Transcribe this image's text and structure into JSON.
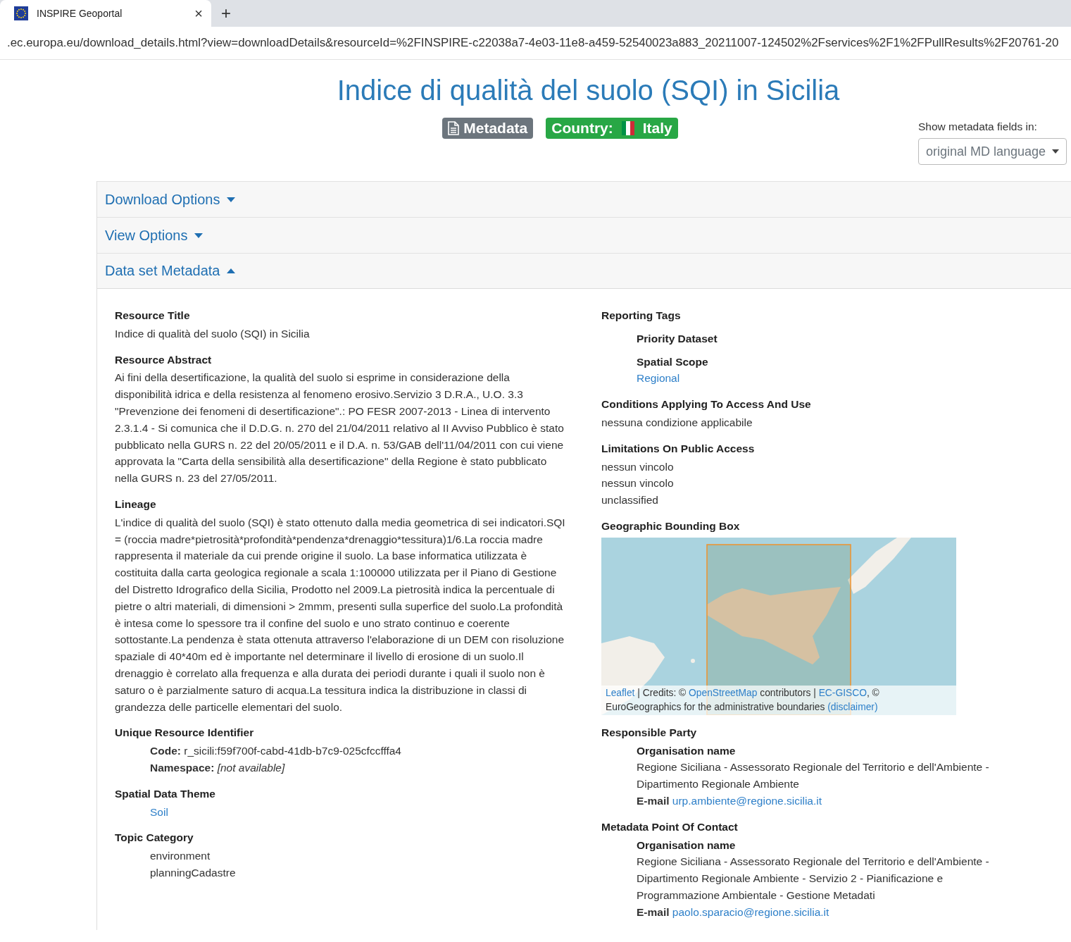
{
  "browser": {
    "tab": {
      "title": "INSPIRE Geoportal",
      "close": "×"
    },
    "new_tab": "+",
    "address": ".ec.europa.eu/download_details.html?view=downloadDetails&resourceId=%2FINSPIRE-c22038a7-4e03-11e8-a459-52540023a883_20211007-124502%2Fservices%2F1%2FPullResults%2F20761-20"
  },
  "page": {
    "title": "Indice di qualità del suolo (SQI) in Sicilia",
    "badges": [
      {
        "kind": "metadata",
        "label": "Metadata"
      },
      {
        "kind": "country",
        "label": "Country:",
        "value": "Italy"
      }
    ],
    "language": {
      "label": "Show metadata fields in:",
      "value": "original MD language"
    }
  },
  "sections": [
    {
      "title": "Download Options",
      "expanded": false
    },
    {
      "title": "View Options",
      "expanded": false
    },
    {
      "title": "Data set Metadata",
      "expanded": true
    }
  ],
  "left_fields": [
    {
      "kind": "text",
      "label": "Resource Title",
      "lines": [
        "Indice di qualità del suolo (SQI) in Sicilia"
      ]
    },
    {
      "kind": "text",
      "label": "Resource Abstract",
      "lines": [
        "Ai fini della desertificazione, la qualità del suolo si esprime in considerazione della disponibilità idrica e della resistenza al fenomeno erosivo.Servizio 3 D.R.A., U.O. 3.3 \"Prevenzione dei fenomeni di desertificazione\".: PO FESR 2007-2013 - Linea di intervento 2.3.1.4 - Si comunica che il D.D.G. n. 270 del 21/04/2011 relativo al II Avviso Pubblico è stato pubblicato nella GURS n. 22 del 20/05/2011 e il D.A. n. 53/GAB dell'11/04/2011 con cui viene approvata la \"Carta della sensibilità alla desertificazione\" della Regione è stato pubblicato nella GURS n. 23 del 27/05/2011."
      ]
    },
    {
      "kind": "text",
      "label": "Lineage",
      "lines": [
        "L'indice di qualità del suolo (SQI) è stato ottenuto dalla media geometrica di sei indicatori.SQI = (roccia madre*pietrosità*profondità*pendenza*drenaggio*tessitura)1/6.La roccia madre rappresenta il materiale da cui prende origine il suolo. La base informatica utilizzata è costituita dalla carta geologica regionale a scala 1:100000 utilizzata per il Piano di Gestione del Distretto Idrografico della Sicilia, Prodotto nel 2009.La pietrosità indica la percentuale di pietre o altri materiali, di dimensioni > 2mmm, presenti sulla superfice del suolo.La profondità è intesa come lo spessore tra il confine del suolo e uno strato continuo e coerente sottostante.La pendenza è stata ottenuta attraverso l'elaborazione di un DEM con risoluzione spaziale di 40*40m ed è importante nel determinare il livello di erosione di un suolo.Il drenaggio è correlato alla frequenza e alla durata dei periodi durante i quali il suolo non è saturo o è parzialmente saturo di acqua.La tessitura indica la distribuzione in classi di grandezza delle particelle elementari del suolo."
      ]
    },
    {
      "kind": "pairs",
      "label": "Unique Resource Identifier",
      "pairs": [
        {
          "key": "Code:",
          "value": "r_sicili:f59f700f-cabd-41db-b7c9-025cfccfffa4",
          "italic": false
        },
        {
          "key": "Namespace:",
          "value": "[not available]",
          "italic": true
        }
      ]
    },
    {
      "kind": "links",
      "label": "Spatial Data Theme",
      "links": [
        "Soil"
      ]
    },
    {
      "kind": "list",
      "label": "Topic Category",
      "lines": [
        "environment",
        "planningCadastre"
      ]
    }
  ],
  "right_fields": [
    {
      "kind": "tags",
      "label": "Reporting Tags",
      "groups": [
        {
          "label": "Priority Dataset"
        },
        {
          "label": "Spatial Scope",
          "links": [
            "Regional"
          ]
        }
      ]
    },
    {
      "kind": "text",
      "label": "Conditions Applying To Access And Use",
      "lines": [
        "nessuna condizione applicabile"
      ]
    },
    {
      "kind": "text",
      "label": "Limitations On Public Access",
      "lines": [
        "nessun vincolo",
        "nessun vincolo",
        "unclassified"
      ]
    },
    {
      "kind": "map",
      "label": "Geographic Bounding Box",
      "attribution": [
        [
          {
            "text": "Leaflet",
            "link": true
          },
          {
            "text": " | Credits: © ",
            "link": false
          },
          {
            "text": "OpenStreetMap",
            "link": true
          },
          {
            "text": " contributors | ",
            "link": false
          },
          {
            "text": "EC-GISCO",
            "link": true
          },
          {
            "text": ", ©",
            "link": false
          }
        ],
        [
          {
            "text": "EuroGeographics for the administrative boundaries ",
            "link": false
          },
          {
            "text": "(disclaimer)",
            "link": true
          }
        ]
      ]
    },
    {
      "kind": "contact",
      "label": "Responsible Party",
      "org_label": "Organisation name",
      "org": "Regione Siciliana - Assessorato Regionale del Territorio e dell'Ambiente - Dipartimento Regionale Ambiente",
      "email_label": "E-mail",
      "email": "urp.ambiente@regione.sicilia.it"
    },
    {
      "kind": "contact",
      "label": "Metadata Point Of Contact",
      "org_label": "Organisation name",
      "org": "Regione Siciliana - Assessorato Regionale del Territorio e dell'Ambiente - Dipartimento Regionale Ambiente - Servizio 2 - Pianificazione e Programmazione Ambientale - Gestione Metadati",
      "email_label": "E-mail",
      "email": "paolo.sparacio@regione.sicilia.it"
    }
  ]
}
